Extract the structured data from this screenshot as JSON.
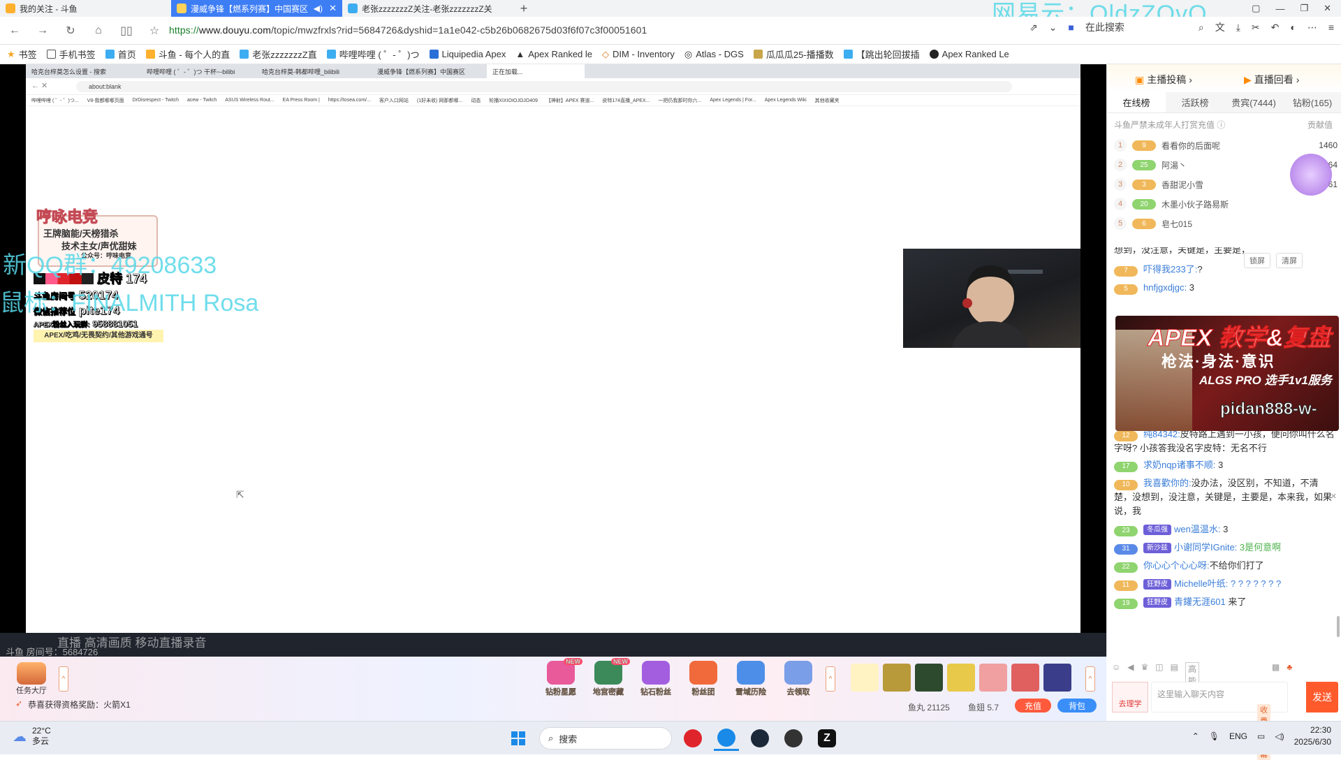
{
  "browser": {
    "tabs": [
      {
        "title": "我的关注 - 斗鱼",
        "active": false
      },
      {
        "title": "漫威争锋【燃系列赛】中国赛区",
        "active": true
      },
      {
        "title": "老张zzzzzzzZ关注-老张zzzzzzzZ关",
        "active": false
      }
    ],
    "new_tab": "+",
    "watermark": "网易云：OldzZOvO",
    "url_scheme": "https://",
    "url_host": "www.douyu.com",
    "url_path": "/topic/mwzfrxls?rid=5684726&dyshid=1a1e042-c5b26b0682675d03f6f07c3f00051601",
    "search_label": "在此搜索",
    "bookmarks": [
      "书签",
      "手机书签",
      "首页",
      "斗鱼 - 每个人的直",
      "老张zzzzzzzZ直",
      "哔哩哔哩 ( ゜- ゜)つ",
      "Liquipedia Apex",
      "Apex Ranked le",
      "DIM - Inventory",
      "Atlas - DGS",
      "瓜瓜瓜25-播播数",
      "【跳出轮回拔插",
      "Apex Ranked Le"
    ]
  },
  "inner_browser": {
    "tabs": [
      "哈克台梓莫怎么设置 - 搜索",
      "哔哩哔哩 ( ゜- ゜)つ 干杯~-bilibi",
      "哈克台梓莫-韩都哔哩_bilibili",
      "漫威争锋【燃系列赛】中国赛区",
      "正在加载..."
    ],
    "url": "about:blank",
    "bookmarks": [
      "哔哩哔哩 ( ゜- ゜)つ...",
      "V8-我都哪哪页面",
      "DrDisrespect - Twitch",
      "acew - Twitch",
      "ASUS Wireless Rout...",
      "EA Press Room |",
      "https://tosea.com/...",
      "客户入口网站",
      "(1好未收) 网那都哪...",
      "动态",
      "轮播XIXIOIOJOJO409",
      "【神射】APEX 赛道...",
      "皮特174直播_APEX...",
      "一把仍我那时你六...",
      "Apex Legends | For...",
      "Apex Legends Wiki",
      "其他收藏夹"
    ]
  },
  "streamer_card": {
    "title": "哼咏电竞",
    "line1": "王牌脑能/天榜猎杀",
    "line2": "技术主女/声优甜妹",
    "line3": "公众号：哼味电竞",
    "social": "皮特 174",
    "bilibili_label": "斗鱼房间号",
    "bilibili": "520174",
    "wechat_label": "微信推荐位",
    "wechat": "pite174",
    "fans_label": "APEX粉丝入玩群:",
    "fans": "958881051",
    "footer": "APEX/吃鸡/无畏契约/其他游戏通号"
  },
  "overlay": {
    "qq": "新QQ群：49208633",
    "mouse": "鼠标：FINALMITH Rosa"
  },
  "room": {
    "id_label": "斗鱼 房间号：",
    "id": "5684726",
    "overlay_text": "直播  高清画质  移动直播录音"
  },
  "right_panel": {
    "top_left": "主播投稿",
    "top_right": "直播回看",
    "tabs": [
      {
        "label": "在线榜",
        "active": true
      },
      {
        "label": "活跃榜",
        "active": false
      },
      {
        "label": "贵宾(7444)",
        "active": false
      },
      {
        "label": "钻粉(165)",
        "active": false
      }
    ],
    "rank_note": "斗鱼严禁未成年人打赏充值",
    "rank_col": "贡献值",
    "ranking": [
      {
        "rank": "1",
        "level": "9",
        "name": "看看你的后面呢",
        "value": "1460"
      },
      {
        "rank": "2",
        "level": "25",
        "name": "阿湯丶",
        "value": "64"
      },
      {
        "rank": "3",
        "level": "3",
        "name": "香甜泥小雪",
        "value": "61"
      },
      {
        "rank": "4",
        "level": "20",
        "name": "木墨小伙子路易斯",
        "value": ""
      },
      {
        "rank": "5",
        "level": "6",
        "name": "皂七015",
        "value": ""
      }
    ],
    "lock_btn": "锁屏",
    "clear_btn": "清屏",
    "chat": [
      {
        "level": "",
        "badge": "",
        "user": "",
        "text": "想到，没注意，关键是，主要是，本来我，如果说，我"
      },
      {
        "level": "7",
        "badge": "",
        "user": "吓得我233了:",
        "text": "?"
      },
      {
        "level": "5",
        "badge": "",
        "user": "hnfjgxdjgc:",
        "text": "3"
      },
      {
        "level": "12",
        "badge": "",
        "user": "纯84342:",
        "text": "皮特路上遇到一小孩，便问你叫什么名字呀? 小孩答我没名字皮特：无名不行"
      },
      {
        "level": "17",
        "badge": "",
        "user": "求奶nqp诸事不顺:",
        "text": "3"
      },
      {
        "level": "10",
        "badge": "",
        "user": "我喜歡你的:",
        "text": "没办法，没区别，不知道，不清楚，没想到，没注意，关键是，主要是，本来我，如果说，我"
      },
      {
        "level": "23",
        "badge": "冬瓜强",
        "user": "wen温温水:",
        "text": "3"
      },
      {
        "level": "31",
        "badge": "新沙兹",
        "user": "小谢同学IGnite:",
        "text": "3是何意啊"
      },
      {
        "level": "22",
        "badge": "",
        "user": "你心心个心心呀:",
        "text": "不给你们打了"
      },
      {
        "level": "11",
        "badge": "狂野皮",
        "user": "Michelle叶纸:",
        "text": "? ? ? ? ? ? ?"
      },
      {
        "level": "19",
        "badge": "狂野皮",
        "user": "青鑵无涯601",
        "text": "来了"
      }
    ],
    "ad": {
      "title": "APEX 教学&复盘",
      "subtitle": "枪法·身法·意识",
      "pro": "ALGS PRO 选手1v1服务",
      "handle": "pidan888-w-"
    },
    "chat_placeholder": "这里输入聊天内容",
    "danmu_tag": "收费的弹幕",
    "send": "发送",
    "zhili": "去理学",
    "quality": "高能"
  },
  "toolbar": {
    "task_hall": "任务大厅",
    "icons": [
      {
        "label": "钻粉星愿",
        "new": "NEW",
        "color": "#e85a9a"
      },
      {
        "label": "地宫密藏",
        "new": "NEW",
        "color": "#3c8a5a"
      },
      {
        "label": "钻石粉丝",
        "new": "",
        "color": "#a35ee0"
      },
      {
        "label": "粉丝团",
        "new": "",
        "color": "#f06a3c"
      },
      {
        "label": "雪域历险",
        "new": "",
        "color": "#4d8fe8"
      },
      {
        "label": "去领取",
        "new": "",
        "color": "#7a9ee8"
      }
    ],
    "award": "恭喜获得资格奖励：火箭X1",
    "fish_ball": "鱼丸 21125",
    "fish_tail": "鱼翅 5.7",
    "recharge": "充值",
    "backpack": "背包"
  },
  "taskbar": {
    "temp": "22°C",
    "weather": "多云",
    "search": "搜索",
    "lang": "ENG",
    "time": "22:30",
    "date": "2025/6/30"
  }
}
